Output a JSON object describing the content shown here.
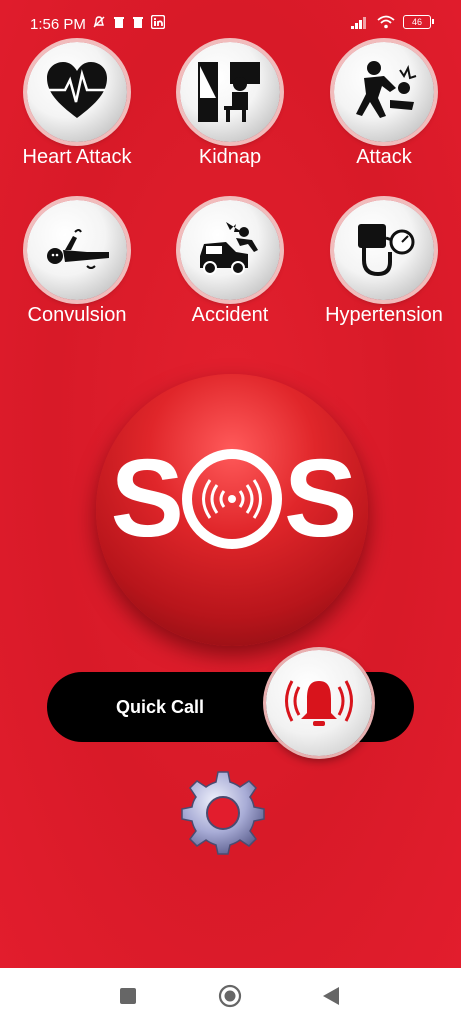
{
  "status_bar": {
    "time": "1:56 PM",
    "battery": "46"
  },
  "emergencies": [
    {
      "label": "Heart Attack",
      "icon": "heart-pulse-icon"
    },
    {
      "label": "Kidnap",
      "icon": "kidnap-icon"
    },
    {
      "label": "Attack",
      "icon": "attack-icon"
    },
    {
      "label": "Convulsion",
      "icon": "convulsion-icon"
    },
    {
      "label": "Accident",
      "icon": "car-accident-icon"
    },
    {
      "label": "Hypertension",
      "icon": "blood-pressure-icon"
    }
  ],
  "sos": {
    "letters_left": "S",
    "letters_right": "S"
  },
  "quick_call": {
    "label": "Quick Call",
    "icon": "alarm-bell-icon"
  },
  "settings": {
    "icon": "gear-icon"
  },
  "colors": {
    "background": "#e21d2d",
    "pill": "#000000",
    "accent": "#d8141c"
  }
}
